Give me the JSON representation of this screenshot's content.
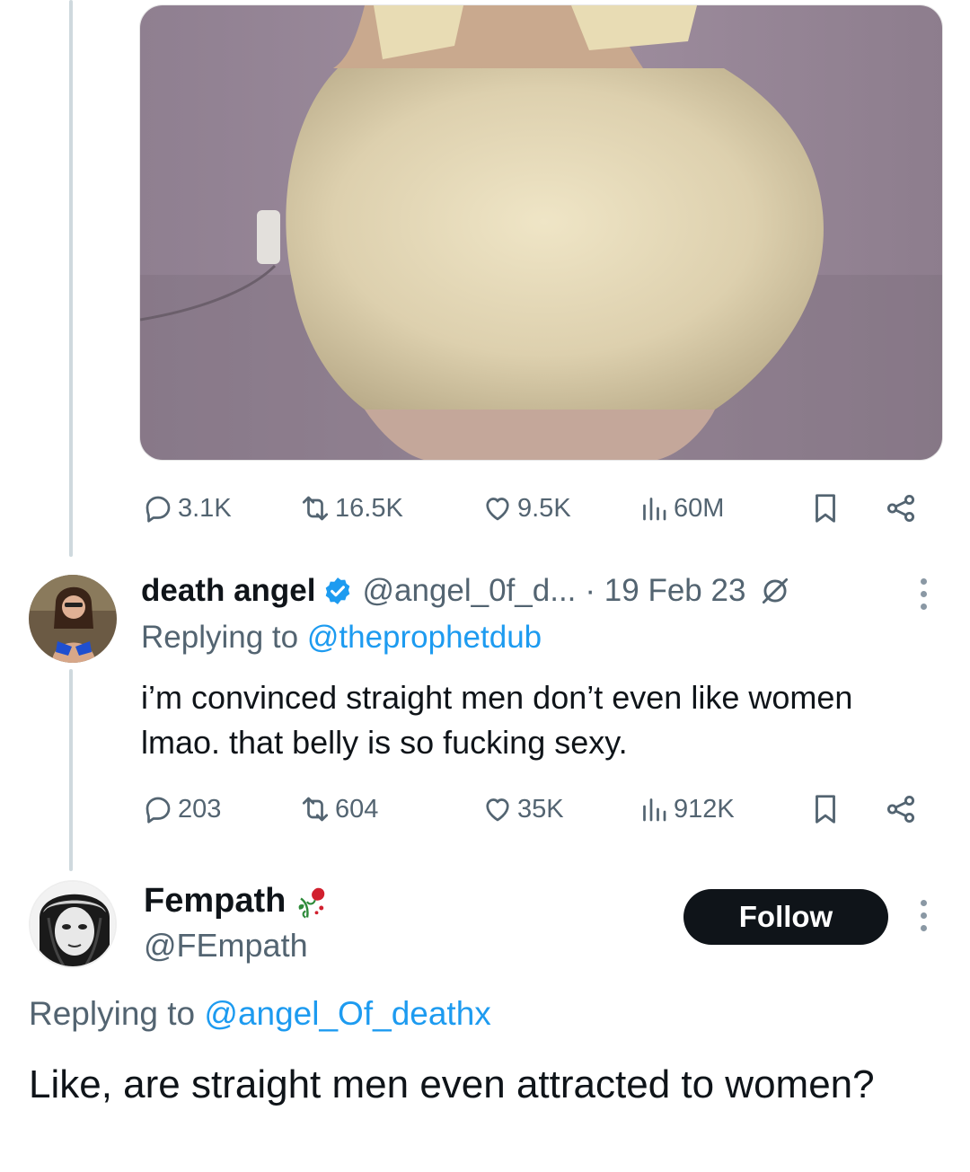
{
  "parent_tweet": {
    "actions": {
      "replies": "3.1K",
      "reposts": "16.5K",
      "likes": "9.5K",
      "views": "60M"
    }
  },
  "reply_tweet": {
    "display_name": "death angel",
    "handle": "@angel_0f_d...",
    "date": "· 19 Feb 23",
    "replying_prefix": "Replying to",
    "replying_to": "@theprophetdub",
    "text": "i’m convinced straight men don’t even like women lmao. that belly is so fucking sexy.",
    "actions": {
      "replies": "203",
      "reposts": "604",
      "likes": "35K",
      "views": "912K"
    }
  },
  "main_tweet": {
    "display_name": "Fempath",
    "handle": "@FEmpath",
    "follow_label": "Follow",
    "replying_prefix": "Replying to",
    "replying_to": "@angel_Of_deathx",
    "text": "Like, are straight men even attracted to women?"
  },
  "colors": {
    "text": "#0f1419",
    "muted": "#536471",
    "link": "#1d9bf0",
    "thread_line": "#cfd9de"
  }
}
